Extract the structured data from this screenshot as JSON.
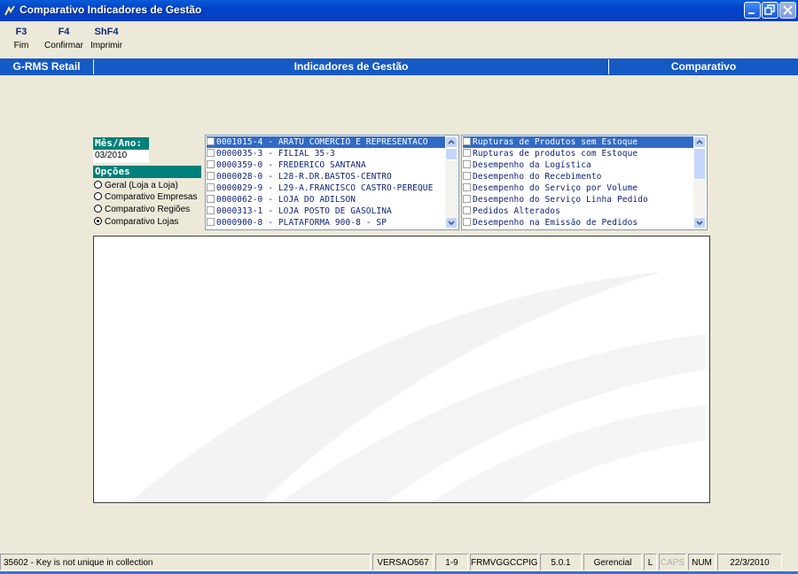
{
  "window": {
    "title": "Comparativo Indicadores de Gestão"
  },
  "toolbar": [
    {
      "key": "F3",
      "label": "Fim"
    },
    {
      "key": "F4",
      "label": "Confirmar"
    },
    {
      "key": "ShF4",
      "label": "Imprimir"
    }
  ],
  "module_bar": {
    "system": "G-RMS Retail",
    "module": "Indicadores de Gestão",
    "screen": "Comparativo"
  },
  "period": {
    "label": "Mês/Ano:",
    "value": "03/2010"
  },
  "options": {
    "label": "Opções",
    "items": [
      {
        "label": "Geral (Loja a Loja)",
        "selected": false
      },
      {
        "label": "Comparativo Empresas",
        "selected": false
      },
      {
        "label": "Comparativo Regiões",
        "selected": false
      },
      {
        "label": "Comparativo Lojas",
        "selected": true
      }
    ]
  },
  "stores_list": [
    {
      "label": "0001015-4 - ARATU COMERCIO E REPRESENTACO",
      "selected": true
    },
    {
      "label": "0000035-3 - FILIAL 35-3",
      "selected": false
    },
    {
      "label": "0000359-0 - FREDERICO SANTANA",
      "selected": false
    },
    {
      "label": "0000028-0 - L28-R.DR.BASTOS-CENTRO",
      "selected": false
    },
    {
      "label": "0000029-9 - L29-A.FRANCISCO CASTRO-PEREQUE",
      "selected": false
    },
    {
      "label": "0000062-0 - LOJA DO ADILSON",
      "selected": false
    },
    {
      "label": "0000313-1 - LOJA POSTO DE GASOLINA",
      "selected": false
    },
    {
      "label": "0000900-8 - PLATAFORMA 900-8 - SP",
      "selected": false
    }
  ],
  "indicators_list": [
    {
      "label": "Rupturas de Produtos sem Estoque",
      "selected": true
    },
    {
      "label": "Rupturas de produtos com Estoque",
      "selected": false
    },
    {
      "label": "Desempenho da Logística",
      "selected": false
    },
    {
      "label": "Desempenho do Recebimento",
      "selected": false
    },
    {
      "label": "Desempenho do Serviço por Volume",
      "selected": false
    },
    {
      "label": "Desempenho do Serviço Linha Pedido",
      "selected": false
    },
    {
      "label": "Pedidos Alterados",
      "selected": false
    },
    {
      "label": "Desempenho na Emissão de Pedidos",
      "selected": false
    }
  ],
  "statusbar": {
    "message": "35602 - Key is not unique in collection",
    "version": "VERSAO567",
    "range": "1-9",
    "form": "FRMVGGCCPIG",
    "release": "5.0.1",
    "profile": "Gerencial",
    "l": "L",
    "caps": "CAPS",
    "num": "NUM",
    "date": "22/3/2010"
  },
  "colors": {
    "title_bar": "#0a4fd0",
    "module_bar": "#1559c4",
    "field_header": "#00807a",
    "selection": "#316ac5",
    "background": "#ece9d8"
  }
}
